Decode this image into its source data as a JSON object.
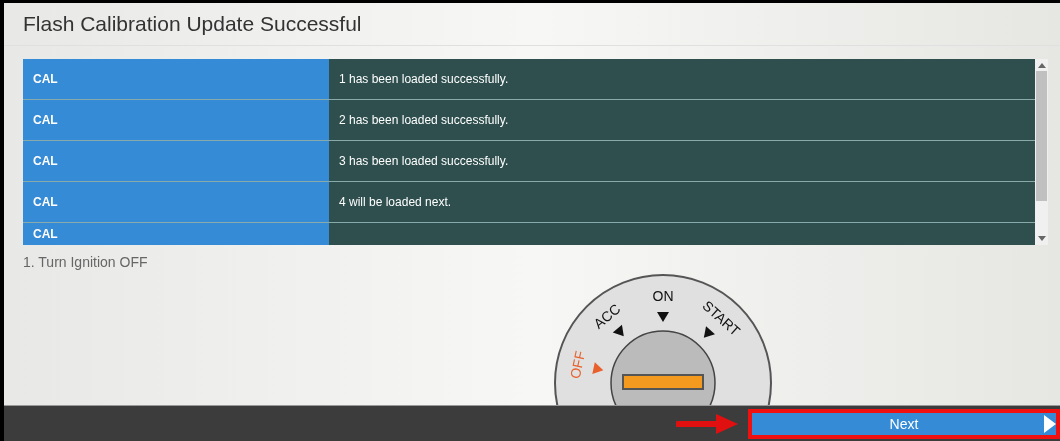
{
  "window": {
    "title": "Flash Calibration Update Successful"
  },
  "table": {
    "rows": [
      {
        "label": "CAL",
        "status": "1 has been loaded successfully."
      },
      {
        "label": "CAL",
        "status": "2 has been loaded successfully."
      },
      {
        "label": "CAL",
        "status": "3 has been loaded successfully."
      },
      {
        "label": "CAL",
        "status": "4 will be loaded next."
      },
      {
        "label": "CAL"
      }
    ]
  },
  "instruction": "1. Turn Ignition OFF",
  "ignition": {
    "labels": [
      {
        "text": "OFF",
        "selected": true
      },
      {
        "text": "ACC",
        "selected": false
      },
      {
        "text": "ON",
        "selected": false
      },
      {
        "text": "START",
        "selected": false
      }
    ]
  },
  "footer": {
    "next_button": {
      "label": "Next",
      "highlighted": true
    }
  }
}
